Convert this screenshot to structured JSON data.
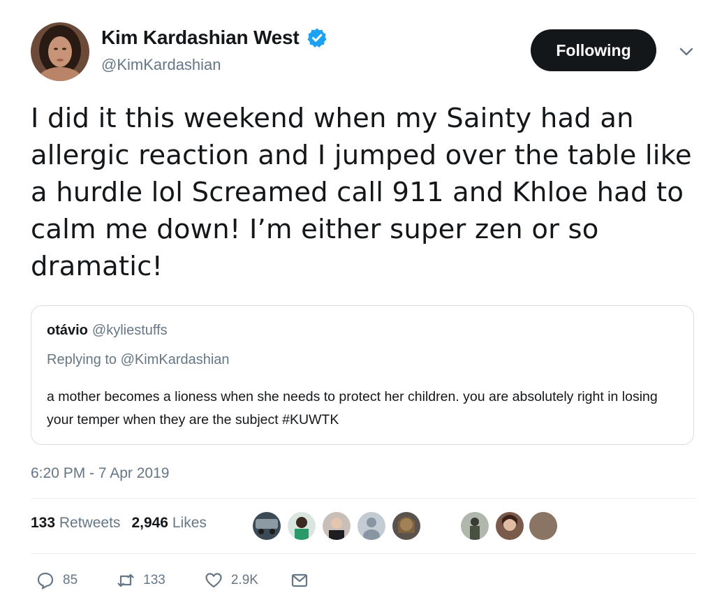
{
  "author": {
    "display_name": "Kim Kardashian West",
    "handle": "@KimKardashian",
    "verified": true,
    "avatar_icon": "profile-photo"
  },
  "follow_button": {
    "label": "Following"
  },
  "menu_icon": "chevron-down-icon",
  "tweet_text": "I did it this weekend when my Sainty had an allergic reaction and I jumped over the table like a hurdle lol Screamed call 911 and Khloe had to calm me down! I’m either super zen or so dramatic!",
  "quoted_tweet": {
    "display_name": "otávio",
    "handle": "@kyliestuffs",
    "replying_to": "Replying to @KimKardashian",
    "text": "a mother becomes a lioness when she needs to protect her children. you are absolutely right in losing your temper when they are the subject #KUWTK"
  },
  "timestamp": "6:20 PM - 7 Apr 2019",
  "stats": {
    "retweets_count": "133",
    "retweets_label": "Retweets",
    "likes_count": "2,946",
    "likes_label": "Likes"
  },
  "actions": {
    "replies": "85",
    "retweets": "133",
    "likes": "2.9K"
  },
  "colors": {
    "text": "#14171a",
    "secondary": "#657786",
    "verified_blue": "#1da1f2",
    "button_bg": "#14171a",
    "border": "#d7dde3"
  }
}
